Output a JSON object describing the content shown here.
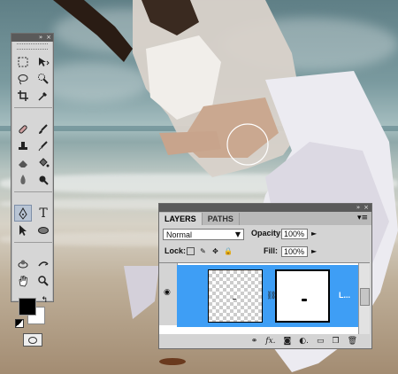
{
  "tools_panel": {
    "icons": [
      "marquee-icon",
      "move-icon",
      "lasso-icon",
      "quick-selection-icon",
      "crop-icon",
      "eyedropper-icon",
      "healing-brush-icon",
      "brush-icon",
      "clone-stamp-icon",
      "history-brush-icon",
      "eraser-icon",
      "paint-bucket-icon",
      "blur-icon",
      "dodge-icon",
      "pen-icon",
      "type-icon",
      "path-selection-icon",
      "ellipse-icon",
      "3d-rotate-icon",
      "3d-orbit-icon",
      "hand-icon",
      "zoom-icon"
    ],
    "foreground_color": "#000000",
    "background_color": "#ffffff"
  },
  "layers_panel": {
    "tabs": [
      {
        "label": "LAYERS",
        "active": true
      },
      {
        "label": "PATHS",
        "active": false
      }
    ],
    "blend_mode": "Normal",
    "opacity_label": "Opacity:",
    "opacity_value": "100%",
    "lock_label": "Lock:",
    "fill_label": "Fill:",
    "fill_value": "100%",
    "layer_name": "L...",
    "selected_row_color": "#3e9ef5"
  }
}
